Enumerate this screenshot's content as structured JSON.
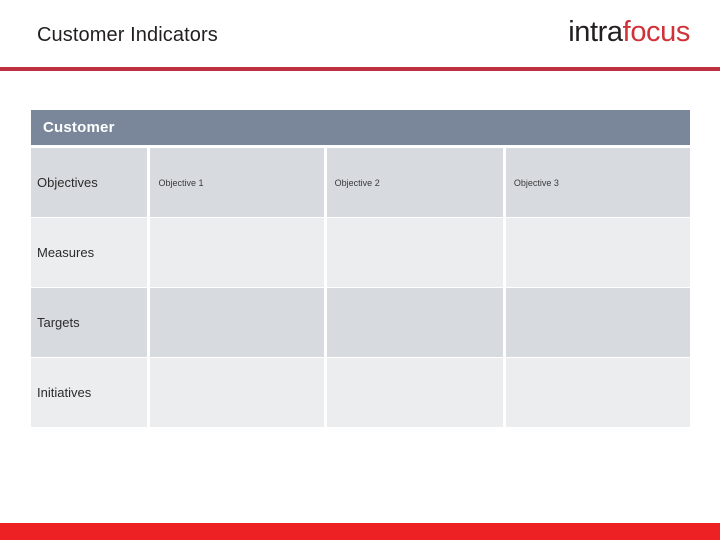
{
  "header": {
    "title": "Customer Indicators",
    "logo": {
      "part1": "intra",
      "part2": "focus",
      "part1_color": "#231f20",
      "part2_color": "#cf3339"
    },
    "rule_color": "#bf3040"
  },
  "scorecard": {
    "band_label": "Customer",
    "band_color": "#7a879b",
    "row_dark_color": "#d7dbe0",
    "row_light_color": "#ecedef",
    "column_headers": [
      "Objective 1",
      "Objective 2",
      "Objective 3"
    ],
    "rows": [
      {
        "label": "Objectives",
        "shade": "dark",
        "show_headers": true,
        "cells": [
          "",
          "",
          ""
        ]
      },
      {
        "label": "Measures",
        "shade": "light",
        "show_headers": false,
        "cells": [
          "",
          "",
          ""
        ]
      },
      {
        "label": "Targets",
        "shade": "dark",
        "show_headers": false,
        "cells": [
          "",
          "",
          ""
        ]
      },
      {
        "label": "Initiatives",
        "shade": "light",
        "show_headers": false,
        "cells": [
          "",
          "",
          ""
        ]
      }
    ]
  },
  "footer": {
    "bar_color": "#ed2024"
  }
}
